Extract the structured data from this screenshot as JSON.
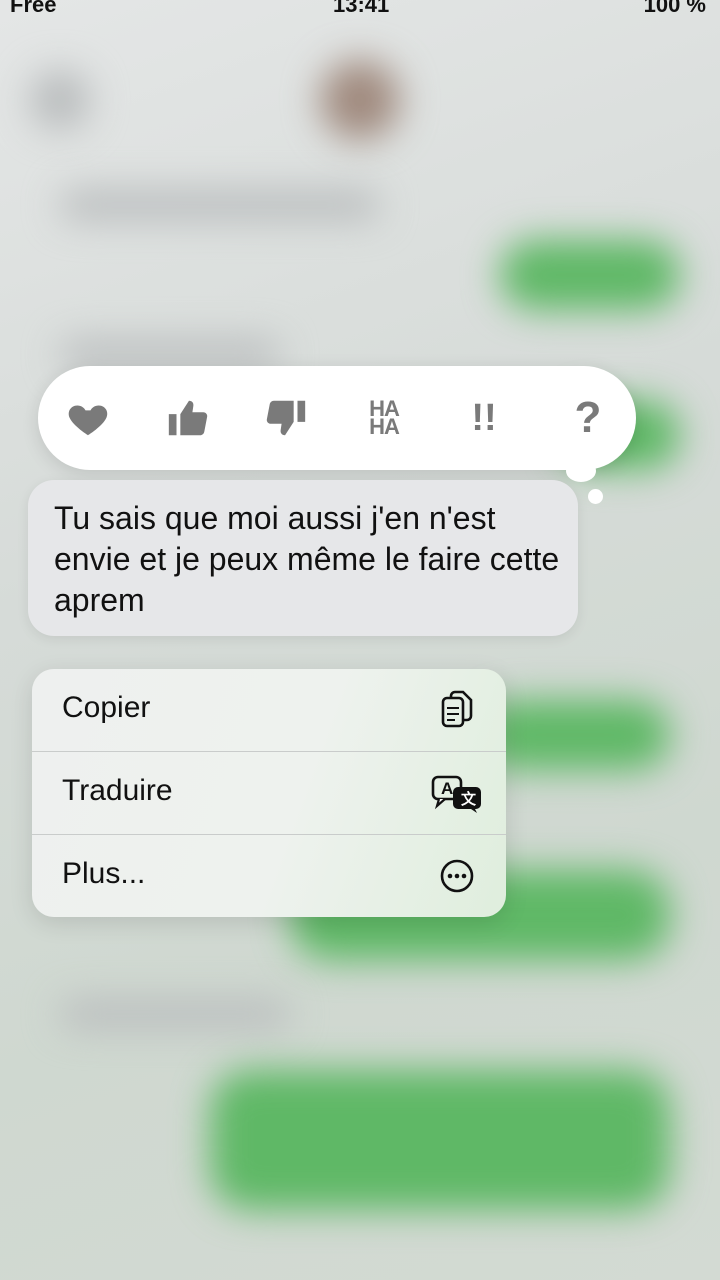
{
  "status_bar": {
    "carrier": "Free",
    "time": "13:41",
    "battery": "100 %"
  },
  "reactions": [
    {
      "name": "heart",
      "icon": "heart-icon"
    },
    {
      "name": "thumbs-up",
      "icon": "thumbs-up-icon"
    },
    {
      "name": "thumbs-down",
      "icon": "thumbs-down-icon"
    },
    {
      "name": "haha",
      "icon": "haha-icon",
      "text_top": "HA",
      "text_bottom": "HA"
    },
    {
      "name": "emphasize",
      "icon": "double-exclamation-icon",
      "text": "!!"
    },
    {
      "name": "question",
      "icon": "question-mark-icon",
      "text": "?"
    }
  ],
  "message": {
    "text": "Tu sais que moi aussi j'en n'est envie et je peux même le faire cette aprem"
  },
  "menu": {
    "items": [
      {
        "label": "Copier",
        "icon": "copy-icon"
      },
      {
        "label": "Traduire",
        "icon": "translate-icon"
      },
      {
        "label": "Plus...",
        "icon": "more-icon"
      }
    ]
  },
  "colors": {
    "imessage_green": "#5fb866",
    "icon_grey": "#7a7a7a"
  }
}
